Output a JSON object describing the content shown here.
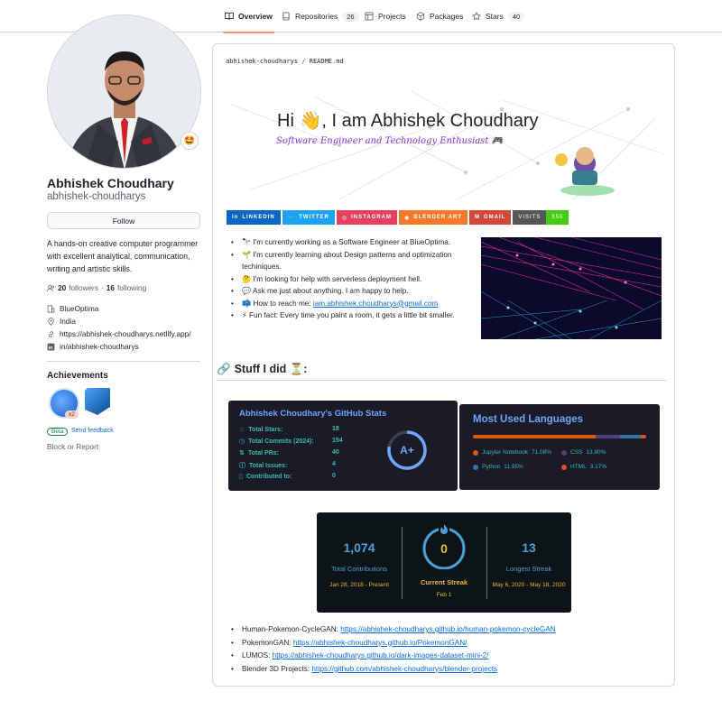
{
  "nav": {
    "tabs": [
      {
        "label": "Overview"
      },
      {
        "label": "Repositories",
        "count": "26"
      },
      {
        "label": "Projects"
      },
      {
        "label": "Packages"
      },
      {
        "label": "Stars",
        "count": "40"
      }
    ]
  },
  "profile": {
    "name": "Abhishek Choudhary",
    "login": "abhishek-choudharys",
    "status_emoji": "🤩",
    "follow_label": "Follow",
    "bio": "A hands-on creative computer programmer with excellent analytical, communication, writing and artistic skills.",
    "followers_count": "20",
    "followers_label": "followers",
    "following_count": "16",
    "following_label": "following",
    "company": "BlueOptima",
    "location": "India",
    "website": "https://abhishek-choudharys.netlify.app/",
    "linkedin": "in/abhishek-choudharys"
  },
  "achievements": {
    "title": "Achievements",
    "multiplier": "x2",
    "beta": "Beta",
    "feedback": "Send feedback",
    "block": "Block or Report"
  },
  "readme": {
    "crumb_user": "abhishek-choudharys",
    "crumb_sep": "/",
    "crumb_file": "README.md",
    "banner_hi": "Hi 👋, I am Abhishek Choudhary",
    "banner_sub": "Software Engineer and Technology Enthusiast 🎮",
    "socials": [
      {
        "label": "LINKEDIN",
        "color": "#0a66c2"
      },
      {
        "label": "TWITTER",
        "color": "#1da1f2"
      },
      {
        "label": "INSTAGRAM",
        "color": "#e4405f"
      },
      {
        "label": "BLENDER ART",
        "color": "#f5792a"
      },
      {
        "label": "GMAIL",
        "color": "#d14836"
      }
    ],
    "visits_label": "VISITS",
    "visits_count": "555",
    "bullets": [
      "🔭 I'm currently working as a Software Engineer at BlueOptima.",
      "🌱 I'm currently learning about Design patterns and optimization techiniques.",
      "🤔 I'm looking for help with serverless deployment hell.",
      "💬 Ask me just about anything. I am happy to help.",
      "📫 How to reach me: ",
      "⚡ Fun fact: Every time you paint a room, it gets a little bit smaller."
    ],
    "email": "iam.abhishek.choudharys@gmail.com",
    "section_title": "Stuff I did ⏳:"
  },
  "stats": {
    "title": "Abhishek Choudhary's GitHub Stats",
    "rows": [
      {
        "label": "Total Stars:",
        "value": "18"
      },
      {
        "label": "Total Commits (2024):",
        "value": "154"
      },
      {
        "label": "Total PRs:",
        "value": "40"
      },
      {
        "label": "Total Issues:",
        "value": "4"
      },
      {
        "label": "Contributed to:",
        "value": "0"
      }
    ],
    "grade": "A+",
    "grade_progress": 0.78
  },
  "languages": {
    "title": "Most Used Languages",
    "items": [
      {
        "name": "Jupyter Notebook",
        "pct": "71.08%",
        "value": 71.08,
        "color": "#da5b0b"
      },
      {
        "name": "CSS",
        "pct": "13.80%",
        "value": 13.8,
        "color": "#563d7c"
      },
      {
        "name": "Python",
        "pct": "11.95%",
        "value": 11.95,
        "color": "#3572a5"
      },
      {
        "name": "HTML",
        "pct": "3.17%",
        "value": 3.17,
        "color": "#e34c26"
      }
    ]
  },
  "streak": {
    "total": "1,074",
    "total_label": "Total Contributions",
    "total_range": "Jan 28, 2018 - Present",
    "current": "0",
    "current_label": "Current Streak",
    "current_date": "Feb 1",
    "longest": "13",
    "longest_label": "Longest Streak",
    "longest_range": "May 6, 2020 - May 18, 2020"
  },
  "projects": [
    {
      "name": "Human-Pokemon-CycleGAN: ",
      "url": "https://abhishek-choudharys.github.io/human-pokemon-cycleGAN"
    },
    {
      "name": "PokemonGAN: ",
      "url": "https://abhishek-choudharys.github.io/PokemonGAN/"
    },
    {
      "name": "LUMOS: ",
      "url": "https://abhishek-choudharys.github.io/dark-images-dataset-mini-2/"
    },
    {
      "name": "Blender 3D Projects: ",
      "url": "https://github.com/abhishek-choudharys/blender-projects"
    }
  ]
}
